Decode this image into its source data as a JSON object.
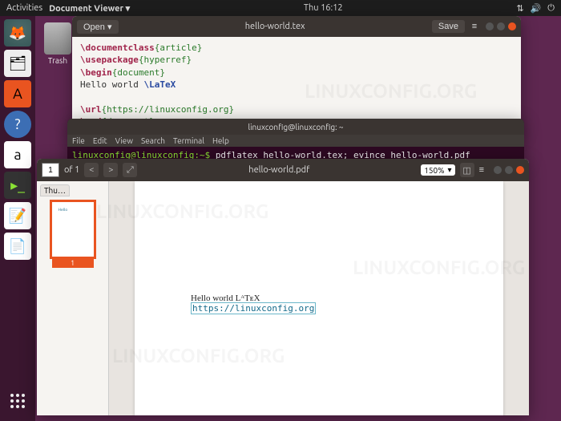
{
  "topbar": {
    "activities": "Activities",
    "app": "Document Viewer ▾",
    "clock": "Thu 16:12"
  },
  "trash": {
    "label": "Trash"
  },
  "launcher": {
    "items": [
      "firefox",
      "files",
      "software",
      "help",
      "amazon",
      "terminal",
      "gedit",
      "evince"
    ]
  },
  "editor": {
    "open": "Open ▾",
    "title": "hello-world.tex",
    "save": "Save",
    "lines": [
      {
        "cmd": "\\documentclass",
        "arg": "{article}"
      },
      {
        "cmd": "\\usepackage",
        "arg": "{hyperref}"
      },
      {
        "cmd": "\\begin",
        "arg": "{document}"
      },
      {
        "text": "Hello world ",
        "blue": "\\LaTeX"
      },
      {
        "text": ""
      },
      {
        "cmd": "\\url",
        "arg": "{https://linuxconfig.org}"
      },
      {
        "cmd": "\\end",
        "arg": "{document}"
      }
    ]
  },
  "terminal": {
    "title": "linuxconfig@linuxconfig: ~",
    "menu": [
      "File",
      "Edit",
      "View",
      "Search",
      "Terminal",
      "Help"
    ],
    "prompt": "linuxconfig@linuxconfig:~$ ",
    "command": "pdflatex hello-world.tex; evince hello-world.pdf"
  },
  "pdf": {
    "page": "1",
    "of": "of 1",
    "title": "hello-world.pdf",
    "zoom": "150%",
    "side_tab": "Thu…",
    "thumb_page": "1",
    "body_line1": "Hello world ",
    "latex": "LᴬTᴇX",
    "body_link": "https://linuxconfig.org"
  },
  "watermark": "LINUXCONFIG.ORG"
}
